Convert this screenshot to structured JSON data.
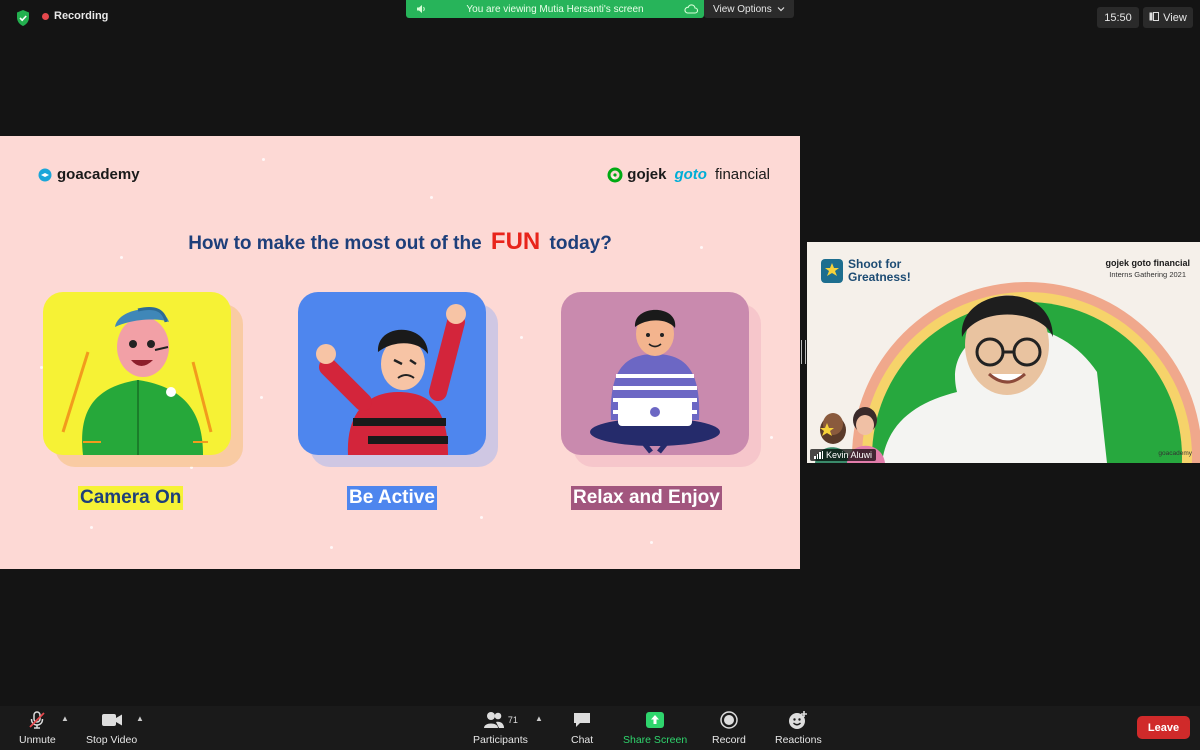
{
  "topbar": {
    "recording_label": "Recording",
    "viewing_banner": "You are viewing Mutia Hersanti's screen",
    "view_options_label": "View Options",
    "clock": "15:50",
    "view_label": "View"
  },
  "slide": {
    "brand_left": "goacademy",
    "brand_gojek": "gojek",
    "brand_goto": "goto",
    "brand_financial": "financial",
    "heading_before": "How to make the most out of the",
    "heading_emphasis": "FUN",
    "heading_after": "today?",
    "cards": [
      {
        "label": "Camera On",
        "color": "#f6f235"
      },
      {
        "label": "Be Active",
        "color": "#4e86ee"
      },
      {
        "label": "Relax and Enjoy",
        "color": "#c98aae"
      }
    ]
  },
  "speaker": {
    "name": "Kevin Aluwi",
    "bg_title_line1": "Shoot for",
    "bg_title_line2": "Greatness!",
    "bg_brand": "gojek goto financial",
    "bg_event": "Interns Gathering 2021",
    "bg_watermark": "goacademy"
  },
  "toolbar": {
    "unmute": "Unmute",
    "stop_video": "Stop Video",
    "participants": "Participants",
    "participants_count": "71",
    "chat": "Chat",
    "share_screen": "Share Screen",
    "record": "Record",
    "reactions": "Reactions",
    "leave": "Leave"
  },
  "colors": {
    "accent_green": "#27b45a",
    "leave_red": "#d02a2a",
    "slide_bg": "#fdd9d5",
    "heading_blue": "#1e3f7a",
    "fun_red": "#e8241b"
  }
}
